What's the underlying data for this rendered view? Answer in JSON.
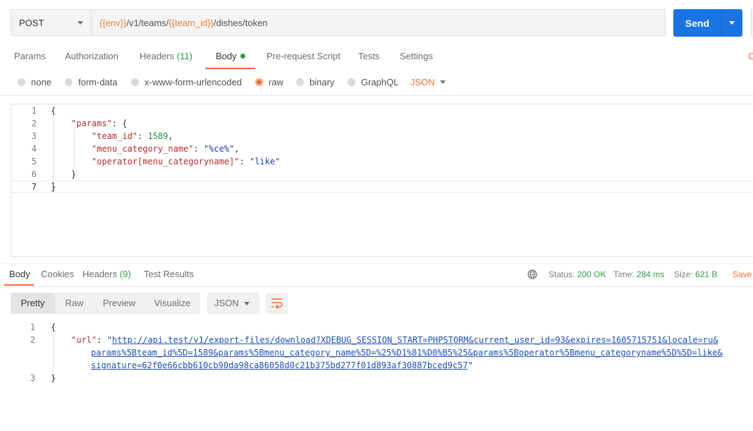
{
  "request": {
    "method": "POST",
    "url_parts": [
      "{{env}}",
      "/v1/teams/",
      "{{team_id}}",
      "/dishes/token"
    ],
    "send_label": "Send"
  },
  "req_tabs": {
    "params": "Params",
    "authorization": "Authorization",
    "headers": "Headers",
    "headers_count": "(11)",
    "body": "Body",
    "prerequest": "Pre-request Script",
    "tests": "Tests",
    "settings": "Settings",
    "cookies_stub": "C"
  },
  "body_types": {
    "none": "none",
    "form_data": "form-data",
    "urlencoded": "x-www-form-urlencoded",
    "raw": "raw",
    "binary": "binary",
    "graphql": "GraphQL",
    "format": "JSON"
  },
  "request_body": {
    "line_numbers": [
      "1",
      "2",
      "3",
      "4",
      "5",
      "6",
      "7"
    ],
    "l1": "{",
    "l2_key": "\"params\"",
    "l2_rest": ": {",
    "l3_key": "\"team_id\"",
    "l3_sep": ": ",
    "l3_val": "1589",
    "l3_end": ",",
    "l4_key": "\"menu_category_name\"",
    "l4_sep": ": ",
    "l4_val": "\"%ce%\"",
    "l4_end": ",",
    "l5_key": "\"operator[menu_categoryname]\"",
    "l5_sep": ": ",
    "l5_val": "\"like\"",
    "l6": "}",
    "l7": "}"
  },
  "resp_tabs": {
    "body": "Body",
    "cookies": "Cookies",
    "headers": "Headers",
    "headers_count": "(9)",
    "test_results": "Test Results"
  },
  "resp_meta": {
    "status_label": "Status:",
    "status_value": "200 OK",
    "time_label": "Time:",
    "time_value": "284 ms",
    "size_label": "Size:",
    "size_value": "621 B",
    "save_label": "Save"
  },
  "view_modes": {
    "pretty": "Pretty",
    "raw": "Raw",
    "preview": "Preview",
    "visualize": "Visualize",
    "format": "JSON"
  },
  "response_body": {
    "line_numbers": [
      "1",
      "2",
      "3"
    ],
    "l1": "{",
    "key": "\"url\"",
    "sep": ": ",
    "quote_open": "\"",
    "url_line1": "http://api.test/v1/export-files/download?XDEBUG_SESSION_START=PHPSTORM&current_user_id=93&expires=1605715751&locale=ru&",
    "url_line2": "params%5Bteam_id%5D=1589&params%5Bmenu_category_name%5D=%25%D1%81%D0%B5%25&params%5Boperator%5Bmenu_categoryname%5D%5D=like&",
    "url_line3": "signature=62f0e66cbb610cb90da98ca86058d0c21b375bd277f01d893af30887bced9c57",
    "quote_close": "\"",
    "l3": "}"
  },
  "colors": {
    "accent": "#f26b3a",
    "send": "#1a74e2",
    "success": "#2e9e46",
    "json_key": "#b02e2e",
    "json_string": "#1d3ea8",
    "json_number": "#1e8a4c"
  }
}
